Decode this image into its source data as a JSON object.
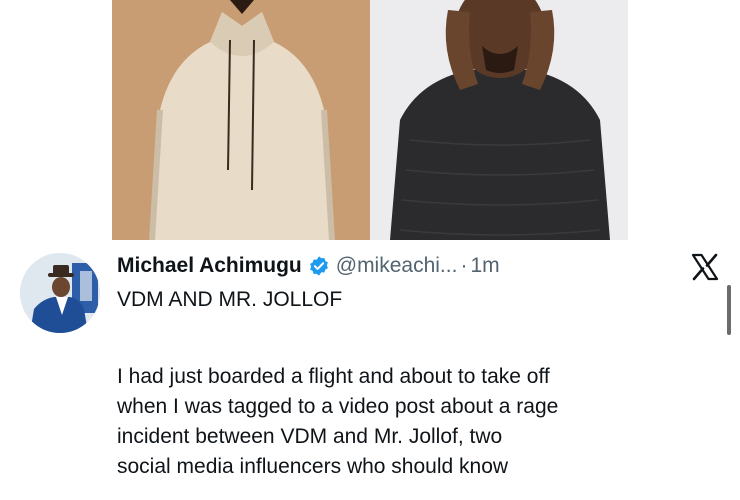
{
  "images": {
    "left": {
      "alt": "man-in-beige-hoodie"
    },
    "right": {
      "alt": "man-in-black-sweater-hands-on-face"
    }
  },
  "tweet": {
    "author_name": "Michael Achimugu",
    "handle": "@mikeachi...",
    "separator": "·",
    "time": "1m",
    "title": "VDM AND MR. JOLLOF",
    "body_lines": [
      "I had just boarded a flight and about to take off",
      "when I was tagged to a video post about a rage",
      "incident between VDM and Mr. Jollof, two",
      "social media influencers who should know"
    ]
  },
  "icons": {
    "verified": "verified-badge-icon",
    "platform": "x-logo-icon"
  },
  "colors": {
    "verified_blue": "#1d9bf0",
    "text_primary": "#0f1419",
    "text_secondary": "#536471"
  }
}
